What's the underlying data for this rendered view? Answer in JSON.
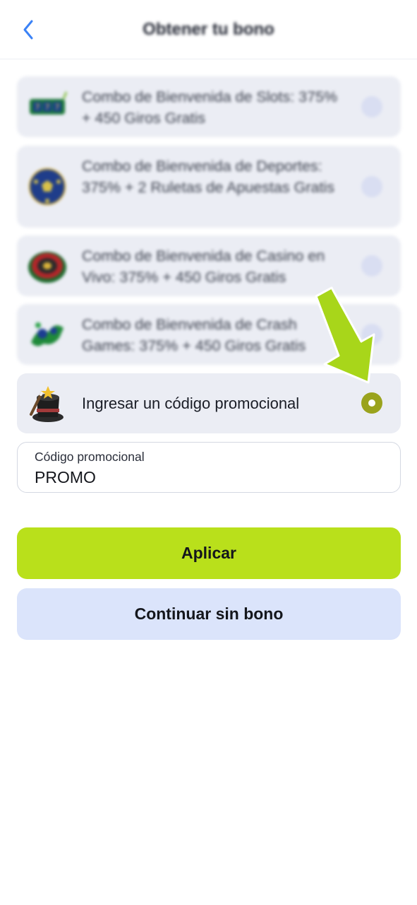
{
  "header": {
    "title": "Obtener tu bono",
    "back_icon": "chevron-left-icon"
  },
  "bonus_options": [
    {
      "label": "Combo de Bienvenida de Slots: 375% + 450 Giros Gratis",
      "icon": "slots-icon",
      "selected": false
    },
    {
      "label": "Combo de Bienvenida de Deportes: 375% + 2 Ruletas de Apuestas Gratis",
      "icon": "soccer-ball-icon",
      "selected": false
    },
    {
      "label": "Combo de Bienvenida de Casino en Vivo: 375% + 450 Giros Gratis",
      "icon": "roulette-icon",
      "selected": false
    },
    {
      "label": "Combo de Bienvenida de Crash Games: 375% + 450 Giros Gratis",
      "icon": "crash-game-icon",
      "selected": false
    }
  ],
  "promo_option": {
    "label": "Ingresar un código promocional",
    "icon": "magic-hat-icon",
    "selected": true
  },
  "promo_field": {
    "label": "Código promocional",
    "value": "PROMO"
  },
  "buttons": {
    "apply": "Aplicar",
    "skip": "Continuar sin bono"
  },
  "colors": {
    "accent": "#b9e01b",
    "radio_selected": "#9aa31d",
    "secondary_button": "#dbe4fb",
    "option_bg": "#ebedf4",
    "pointer_arrow": "#a8d61a"
  }
}
